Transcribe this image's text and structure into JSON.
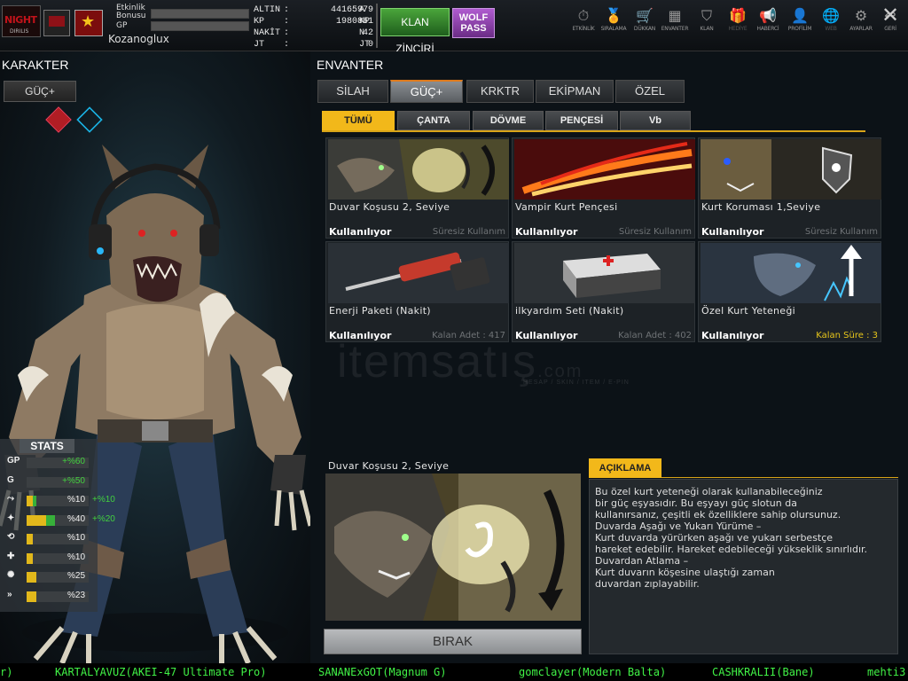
{
  "header": {
    "logo_text": "NIGHT",
    "logo_sub": "DIRILIS",
    "etkinlik_label": "Etkinlik Bonusu",
    "gp_label": "GP",
    "username": "Kozanoglux",
    "currency": [
      {
        "label": "ALTIN",
        "value": "44165979",
        "unit": "A"
      },
      {
        "label": "KP",
        "value": "1980861",
        "unit": "KP"
      },
      {
        "label": "NAKİT",
        "value": "42",
        "unit": "N"
      },
      {
        "label": "JT",
        "value": "0",
        "unit": "JT"
      }
    ],
    "klan_button": "KLAN ZİNCİRİ",
    "wolf_pass": "WOLF PASS",
    "nav": [
      {
        "label": "ETKİNLİK",
        "icon": "stopwatch-icon",
        "glyph": "⏱"
      },
      {
        "label": "SIRALAMA",
        "icon": "medal-icon",
        "glyph": "🏅"
      },
      {
        "label": "DÜKKAN",
        "icon": "cart-icon",
        "glyph": "🛒"
      },
      {
        "label": "ENVANTER",
        "icon": "inventory-icon",
        "glyph": "▦"
      },
      {
        "label": "KLAN",
        "icon": "shield-icon",
        "glyph": "⛉"
      },
      {
        "label": "HEDİYE",
        "icon": "gift-icon",
        "glyph": "🎁"
      },
      {
        "label": "HABERCİ",
        "icon": "megaphone-icon",
        "glyph": "📢"
      },
      {
        "label": "PROFİLİM",
        "icon": "profile-icon",
        "glyph": "👤"
      },
      {
        "label": "WEB",
        "icon": "globe-icon",
        "glyph": "🌐"
      },
      {
        "label": "AYARLAR",
        "icon": "gear-icon",
        "glyph": "⚙"
      },
      {
        "label": "GERİ",
        "icon": "back-icon",
        "glyph": "↩"
      }
    ],
    "close_glyph": "✕"
  },
  "left": {
    "title": "KARAKTER",
    "tab": "GÜÇ+",
    "stats_title": "STATS",
    "stats": [
      {
        "icon": "GP",
        "value": "+%60",
        "fill": 0,
        "green": true,
        "bonus": ""
      },
      {
        "icon": "G",
        "value": "+%50",
        "fill": 0,
        "green": true,
        "bonus": ""
      },
      {
        "icon": "⤳",
        "value": "%10",
        "fill": 0.1,
        "green_part": 0.05,
        "bonus": "+%10"
      },
      {
        "icon": "✦",
        "value": "%40",
        "fill": 0.32,
        "green_part": 0.14,
        "bonus": "+%20"
      },
      {
        "icon": "⟲",
        "value": "%10",
        "fill": 0.1,
        "bonus": ""
      },
      {
        "icon": "✚",
        "value": "%10",
        "fill": 0.1,
        "bonus": ""
      },
      {
        "icon": "✺",
        "value": "%25",
        "fill": 0.16,
        "bonus": ""
      },
      {
        "icon": "»",
        "value": "%23",
        "fill": 0.15,
        "bonus": ""
      }
    ]
  },
  "right": {
    "title": "ENVANTER",
    "tabs": [
      "SİLAH",
      "GÜÇ+",
      "KRKTR",
      "EKİPMAN",
      "ÖZEL"
    ],
    "active_tab": 1,
    "sub_tabs": [
      "TÜMÜ",
      "ÇANTA",
      "DÖVME",
      "PENÇESİ",
      "Vb"
    ],
    "active_sub_tab": 0,
    "items": [
      {
        "name": "Duvar Koşusu 2, Seviye",
        "status": "Kullanılıyor",
        "info": "Süresiz Kullanım",
        "highlight": false,
        "art": "wallrun"
      },
      {
        "name": "Vampir Kurt Pençesi",
        "status": "Kullanılıyor",
        "info": "Süresiz Kullanım",
        "highlight": false,
        "art": "claw"
      },
      {
        "name": "Kurt Koruması 1,Seviye",
        "status": "Kullanılıyor",
        "info": "Süresiz Kullanım",
        "highlight": false,
        "art": "shield"
      },
      {
        "name": "Enerji Paketi (Nakit)",
        "status": "Kullanılıyor",
        "info": "Kalan Adet : 417",
        "highlight": false,
        "art": "syringe"
      },
      {
        "name": "ilkyardım Seti (Nakit)",
        "status": "Kullanılıyor",
        "info": "Kalan Adet : 402",
        "highlight": false,
        "art": "medkit"
      },
      {
        "name": "Özel Kurt Yeteneği",
        "status": "Kullanılıyor",
        "info": "Kalan Süre : 3",
        "highlight": true,
        "art": "special"
      }
    ],
    "watermark": "itemsatış",
    "watermark_com": ".com",
    "watermark_sub": "HESAP / SKIN / ITEM / E-PIN",
    "detail_title": "Duvar Koşusu 2, Seviye",
    "drop_button": "BIRAK",
    "desc_title": "AÇIKLAMA",
    "description": [
      "Bu özel kurt yeteneği olarak kullanabileceğiniz",
      "bir güç eşyasıdır.  Bu eşyayı güç slotun da",
      "kullanırsanız, çeşitli ek özelliklere sahip olursunuz.",
      "Duvarda Aşağı ve Yukarı Yürüme –",
      "Kurt duvarda yürürken aşağı ve yukarı serbestçe",
      "hareket edebilir. Hareket edebileceği yükseklik sınırlıdır.",
      "Duvardan Atlama –",
      "Kurt duvarın köşesine ulaştığı zaman",
      "duvardan zıplayabilir."
    ]
  },
  "ticker": [
    "r)",
    "KARTALYAVUZ(AKEI-47 Ultimate Pro)",
    "SANANExGOT(Magnum G)",
    "gomclayer(Modern Balta)",
    "CASHKRALII(Bane)",
    "mehti3"
  ],
  "colors": {
    "accent": "#f2b81a",
    "green": "#43d13f",
    "klan": "#3a9a31",
    "wolf_pass": "#9b4cbf"
  }
}
